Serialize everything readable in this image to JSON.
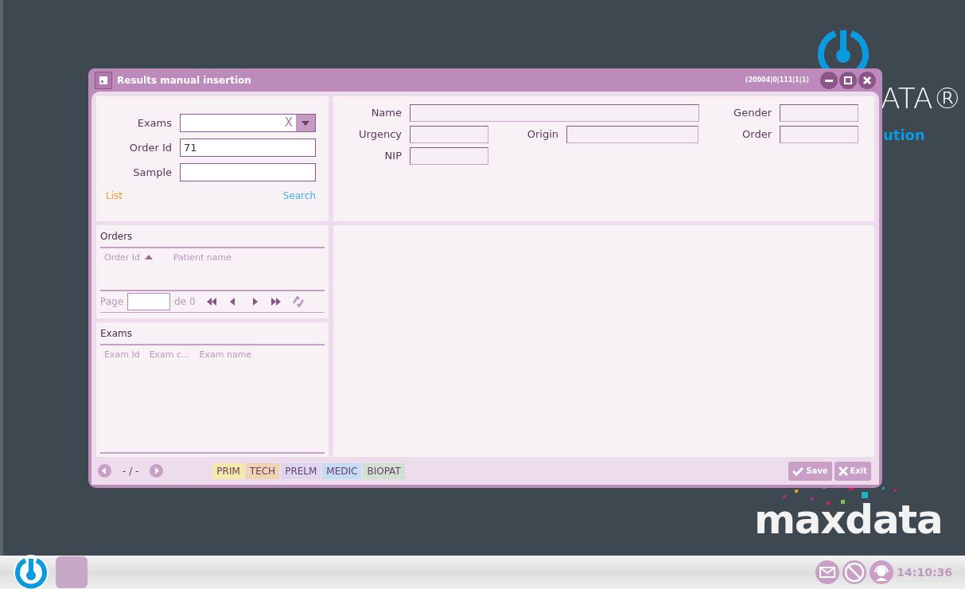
{
  "desktop": {
    "brand_fragment": "ATA®",
    "tagline_fragment": "ution",
    "logo_text": "maxdata"
  },
  "window": {
    "title": "Results manual insertion",
    "code": "(20004|0|111|1|1)"
  },
  "search": {
    "fields": [
      {
        "label": "Exams",
        "kind": "combo",
        "clear": "X"
      },
      {
        "label": "Order Id",
        "kind": "text",
        "value": "71"
      },
      {
        "label": "Sample",
        "kind": "text"
      }
    ],
    "list_link": "List",
    "search_link": "Search"
  },
  "patient": {
    "fields": [
      {
        "label": "Name",
        "kind": "wide"
      },
      {
        "label": "Gender",
        "kind": "short"
      },
      {
        "label": "Urgency",
        "kind": "short"
      },
      {
        "label": "Origin",
        "kind": "long"
      },
      {
        "label": "Order",
        "kind": "short"
      },
      {
        "label": "NIP",
        "kind": "short"
      }
    ]
  },
  "orders": {
    "title": "Orders",
    "columns": [
      {
        "label": "Order Id",
        "sorted": true
      },
      {
        "label": "Patient name",
        "sorted": false
      }
    ],
    "pager": {
      "label": "Page",
      "of": "de 0"
    }
  },
  "exams": {
    "title": "Exams",
    "columns": [
      "Exam Id",
      "Exam c...",
      "Exam name"
    ]
  },
  "footer": {
    "position": "- / -",
    "levels": [
      {
        "label": "PRIM",
        "color": "#f5eaa8"
      },
      {
        "label": "TECH",
        "color": "#efd4b2"
      },
      {
        "label": "PRELM",
        "color": "#dcd6ef"
      },
      {
        "label": "MEDIC",
        "color": "#c4dcf4"
      },
      {
        "label": "BIOPAT",
        "color": "#cfe1d1"
      }
    ],
    "buttons": [
      {
        "label": "Save",
        "kind": "save"
      },
      {
        "label": "Exit",
        "kind": "exit"
      }
    ]
  },
  "taskbar": {
    "clock": "14:10:36"
  }
}
